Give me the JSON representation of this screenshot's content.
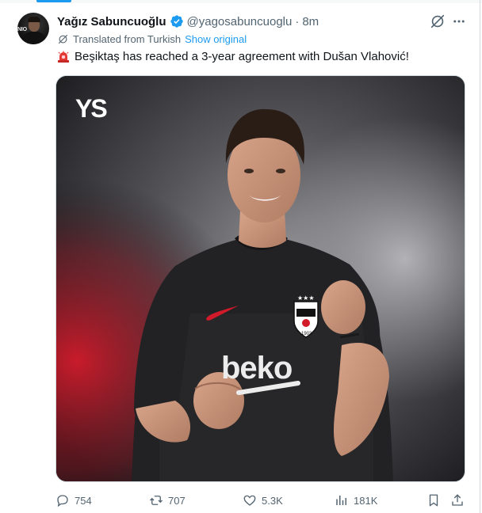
{
  "tweet": {
    "author_name": "Yağız Sabuncuoğlu",
    "handle": "@yagosabuncuoglu",
    "separator": "·",
    "time": "8m",
    "translated_label": "Translated from Turkish",
    "show_original": "Show original",
    "text": "Beşiktaş has reached a 3-year agreement with Dušan Vlahović!",
    "emoji_icon": "police-siren-icon"
  },
  "avatar": {
    "overlay_text": "NIO"
  },
  "media": {
    "watermark": "YS",
    "sponsor": "beko",
    "crest_year": "1903"
  },
  "actions": {
    "replies": "754",
    "reposts": "707",
    "likes": "5.3K",
    "views": "181K"
  },
  "colors": {
    "accent": "#1d9bf0",
    "text": "#0f1419",
    "muted": "#536471"
  }
}
